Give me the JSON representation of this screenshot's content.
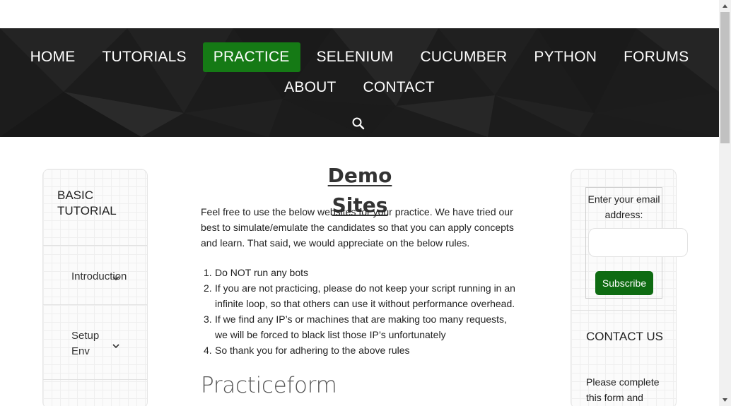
{
  "nav": {
    "row1": [
      "HOME",
      "TUTORIALS",
      "PRACTICE",
      "SELENIUM",
      "CUCUMBER",
      "PYTHON",
      "FORUMS"
    ],
    "row2": [
      "ABOUT",
      "CONTACT"
    ],
    "active": "PRACTICE",
    "search_icon": "search-icon"
  },
  "left_sidebar": {
    "title": "BASIC TUTORIAL",
    "items": [
      {
        "label": "Introduction",
        "icon": "chevron-down-icon"
      },
      {
        "label": "Setup Env",
        "icon": "chevron-down-icon"
      }
    ]
  },
  "main": {
    "title": "Demo Sites",
    "intro": "Feel free to use the below websites for your practice. We have tried our best to simulate/emulate the candidates so that you can apply concepts and learn. That said, we would appreciate on the below rules.",
    "rules": [
      {
        "num": "1.",
        "text": "Do NOT run any bots"
      },
      {
        "num": "2.",
        "text": "If you are not practicing, please do not keep your script running in an infinite loop, so that others can use it without performance overhead."
      },
      {
        "num": "3.",
        "text": "If we find any IP’s or machines that are making too many requests, we will be forced to black list those IP’s unfortunately"
      },
      {
        "num": "4.",
        "text": "So thank you for adhering to the above rules"
      }
    ],
    "section_title": "Practiceform"
  },
  "right_sidebar": {
    "subscribe_label": "Enter your email address:",
    "email_value": "",
    "subscribe_button": "Subscribe",
    "contact_title": "CONTACT US",
    "contact_text": "Please complete this form and"
  },
  "colors": {
    "header_bg": "#1e1e1e",
    "active_nav": "#157a15",
    "subscribe_button": "#0e6b12"
  }
}
